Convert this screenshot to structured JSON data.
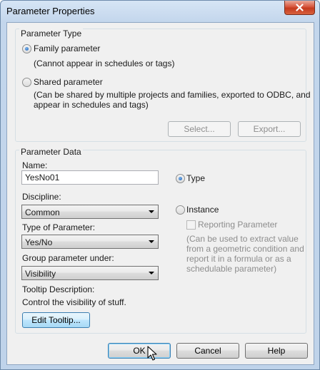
{
  "window": {
    "title": "Parameter Properties",
    "close_glyph": "✕"
  },
  "parameter_type": {
    "group_label": "Parameter Type",
    "family": {
      "label": "Family parameter",
      "description": "(Cannot appear in schedules or tags)",
      "selected": true
    },
    "shared": {
      "label": "Shared parameter",
      "description_line1": "(Can be shared by multiple projects and families, exported to ODBC, and",
      "description_line2": "appear in schedules and tags)",
      "selected": false
    },
    "select_button": "Select...",
    "export_button": "Export..."
  },
  "parameter_data": {
    "group_label": "Parameter Data",
    "name_label": "Name:",
    "name_value": "YesNo01",
    "discipline_label": "Discipline:",
    "discipline_value": "Common",
    "type_label": "Type of Parameter:",
    "type_value": "Yes/No",
    "group_under_label": "Group parameter under:",
    "group_under_value": "Visibility",
    "tooltip_label": "Tooltip Description:",
    "tooltip_value": "Control the visibility of stuff.",
    "edit_tooltip_button": "Edit Tooltip...",
    "type_radio": {
      "label": "Type",
      "selected": true
    },
    "instance_radio": {
      "label": "Instance",
      "selected": false
    },
    "reporting": {
      "label": "Reporting Parameter",
      "checked": false,
      "note_line1": "(Can be used to extract value",
      "note_line2": "from a geometric condition and",
      "note_line3": "report it in a formula or as a",
      "note_line4": "schedulable parameter)"
    }
  },
  "footer": {
    "ok_button": "OK",
    "cancel_button": "Cancel",
    "help_button": "Help"
  },
  "colors": {
    "titlebar": "#c3d6ec",
    "client": "#f0f0f0",
    "close": "#c43a1e",
    "focus_border": "#3c7fb1"
  }
}
